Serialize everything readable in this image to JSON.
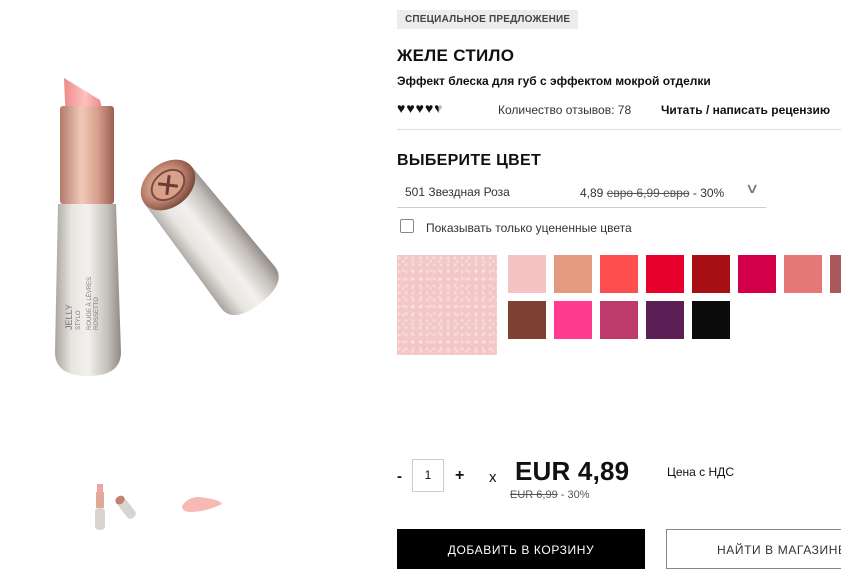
{
  "gallery": {
    "main_image": "lipstick-product-photo",
    "product_lettering": "JELLY STYLO ROUGE À LÈVRES ROSSETTO",
    "thumbnails": [
      "lipstick-thumbnail",
      "swatch-smear-thumbnail"
    ]
  },
  "product": {
    "badge": "СПЕЦИАЛЬНОЕ ПРЕДЛОЖЕНИЕ",
    "title": "ЖЕЛЕ СТИЛО",
    "subtitle": "Эффект блеска для губ с эффектом мокрой отделки",
    "rating": {
      "value": 4.5,
      "max": 5
    },
    "review_count": "Количество отзывов: 78",
    "review_link": "Читать / написать рецензию"
  },
  "shade": {
    "heading": "ВЫБЕРИТЕ ЦВЕТ",
    "selected_name": "501 Звездная Роза",
    "selected_price": "4,89",
    "selected_old_price": "евро 6,99 евро",
    "selected_discount": "- 30%",
    "discount_only_label": "Показывать только уцененные цвета",
    "selected_color": "#f3c7c7",
    "swatches": [
      "#f4c4c4",
      "#e39a7e",
      "#fd4e50",
      "#e8002d",
      "#a80f15",
      "#d30049",
      "#e57777",
      "#a85a5a",
      "#7e4030",
      "#ff3b8f",
      "#bd3a6a",
      "#5b1e55",
      "#0b0b0c"
    ]
  },
  "purchase": {
    "minus": "-",
    "quantity": "1",
    "plus": "+",
    "times": "x",
    "price": "EUR 4,89",
    "vat_label": "Цена с НДС",
    "old_price": "EUR 6,99",
    "discount": "- 30%",
    "add_to_cart": "ДОБАВИТЬ В КОРЗИНУ",
    "find_in_store": "НАЙТИ В МАГАЗИНЕ"
  }
}
